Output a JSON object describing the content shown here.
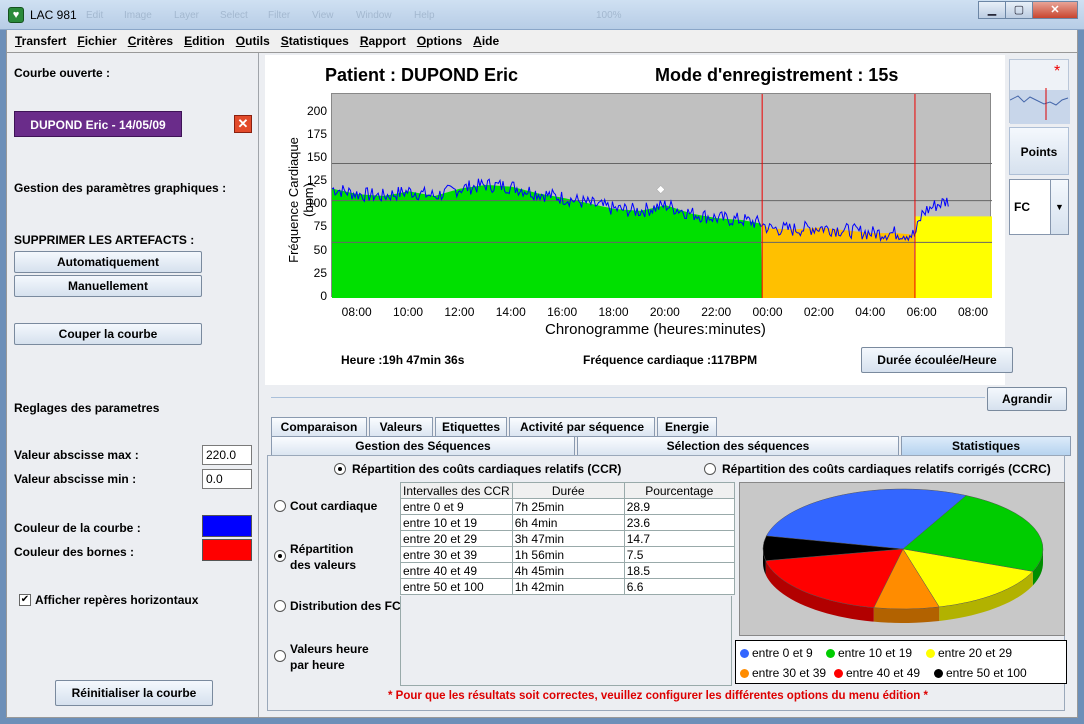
{
  "window": {
    "title": "LAC 981",
    "ghost_menu": [
      "Edit",
      "Image",
      "Layer",
      "Select",
      "Filter",
      "View",
      "Window",
      "Help"
    ],
    "zoom": "100%"
  },
  "menu": [
    {
      "first": "T",
      "rest": "ransfert"
    },
    {
      "first": "F",
      "rest": "ichier"
    },
    {
      "first": "C",
      "rest": "ritères"
    },
    {
      "first": "E",
      "rest": "dition"
    },
    {
      "first": "O",
      "rest": "utils"
    },
    {
      "first": "S",
      "rest": "tatistiques"
    },
    {
      "first": "R",
      "rest": "apport"
    },
    {
      "first": "O",
      "rest": "ptions"
    },
    {
      "first": "A",
      "rest": "ide"
    }
  ],
  "left": {
    "courbe_ouverte": "Courbe ouverte :",
    "curve_button": "DUPOND Eric  - 14/05/09",
    "gestion": "Gestion des paramètres graphiques :",
    "supprimer": "SUPPRIMER LES ARTEFACTS :",
    "auto": "Automatiquement",
    "manual": "Manuellement",
    "couper": "Couper la courbe",
    "reglages": "Reglages des parametres",
    "abs_max_label": "Valeur abscisse max :",
    "abs_max": "220.0",
    "abs_min_label": "Valeur abscisse min :",
    "abs_min": "0.0",
    "couleur_courbe": "Couleur de la courbe :",
    "couleur_bornes": "Couleur des bornes :",
    "color_curve": "#0000ff",
    "color_bounds": "#ff0000",
    "afficher": "Afficher repères horizontaux",
    "afficher_checked": true,
    "reinit": "Réinitialiser la courbe"
  },
  "chart": {
    "patient": "Patient : DUPOND Eric",
    "mode": "Mode d'enregistrement : 15s",
    "heure": "Heure :19h 47min 36s",
    "freq": "Fréquence cardiaque :117BPM",
    "duree_btn": "Durée écoulée/Heure"
  },
  "chart_data": {
    "type": "area",
    "xlabel": "Chronogramme (heures:minutes)",
    "ylabel": "Fréquence Cardiaque (bpm)",
    "yticks": [
      0,
      25,
      50,
      75,
      100,
      125,
      150,
      175,
      200
    ],
    "ylim": [
      0,
      220
    ],
    "xticks": [
      "08:00",
      "10:00",
      "12:00",
      "14:00",
      "16:00",
      "18:00",
      "20:00",
      "22:00",
      "00:00",
      "02:00",
      "04:00",
      "06:00",
      "08:00"
    ],
    "xlim_hours": [
      7,
      32.7
    ],
    "horizontal_refs": [
      60,
      105,
      145
    ],
    "vertical_markers_hours": [
      23.75,
      29.7
    ],
    "zones": [
      {
        "from_hours": 7,
        "to_hours": 23.75,
        "color": "#00e000"
      },
      {
        "from_hours": 23.75,
        "to_hours": 29.7,
        "color": "#ffc000"
      },
      {
        "from_hours": 29.7,
        "to_hours": 32.7,
        "color": "#ffff00"
      }
    ],
    "yellow_level": 88,
    "series": [
      {
        "color": "#0000ff",
        "x_hours": [
          7,
          8,
          9,
          10,
          11,
          12,
          13,
          14,
          15,
          16,
          17,
          18,
          19,
          20,
          21,
          22,
          23,
          23.75,
          24,
          25,
          26,
          27,
          28,
          29,
          29.7,
          30,
          30.5,
          31
        ],
        "values": [
          118,
          112,
          110,
          115,
          110,
          118,
          122,
          120,
          113,
          108,
          102,
          96,
          94,
          100,
          91,
          86,
          84,
          80,
          75,
          74,
          76,
          73,
          70,
          70,
          68,
          92,
          100,
          105
        ]
      }
    ],
    "marker": {
      "hours": 19.8,
      "value": 117
    }
  },
  "side": {
    "points": "Points",
    "select": "FC"
  },
  "agrandir": "Agrandir",
  "tabs_row1": [
    "Comparaison",
    "Valeurs",
    "Etiquettes",
    "Activité par séquence",
    "Energie"
  ],
  "tabs_row2": [
    "Gestion des Séquences",
    "Sélection des séquences",
    "Statistiques"
  ],
  "stats": {
    "radio_ccr": "Répartition des coûts cardiaques relatifs (CCR)",
    "radio_ccrc": "Répartition des coûts cardiaques relatifs corrigés (CCRC)",
    "opt_cout": "Cout cardiaque",
    "opt_rep1": "Répartition",
    "opt_rep2": "des valeurs",
    "opt_dist": "Distribution des FC",
    "opt_val1": "Valeurs heure",
    "opt_val2": "par heure",
    "headers": [
      "Intervalles des CCR",
      "Durée",
      "Pourcentage"
    ],
    "rows": [
      [
        "entre 0 et 9",
        "7h 25min",
        "28.9"
      ],
      [
        "entre 10 et 19",
        "6h 4min",
        "23.6"
      ],
      [
        "entre 20 et 29",
        "3h 47min",
        "14.7"
      ],
      [
        "entre 30 et 39",
        "1h 56min",
        "7.5"
      ],
      [
        "entre 40 et 49",
        "4h 45min",
        "18.5"
      ],
      [
        "entre 50 et 100",
        "1h 42min",
        "6.6"
      ]
    ],
    "legend": [
      {
        "label": "entre 0 et 9",
        "color": "#3366ff"
      },
      {
        "label": "entre 10 et 19",
        "color": "#00cc00"
      },
      {
        "label": "entre 20 et 29",
        "color": "#ffff00"
      },
      {
        "label": "entre 30 et 39",
        "color": "#ff8c00"
      },
      {
        "label": "entre 40 et 49",
        "color": "#ff0000"
      },
      {
        "label": "entre 50 et 100",
        "color": "#000000"
      }
    ],
    "note": "* Pour que les résultats soit correctes, veuillez configurer les différentes options du menu édition  *"
  }
}
